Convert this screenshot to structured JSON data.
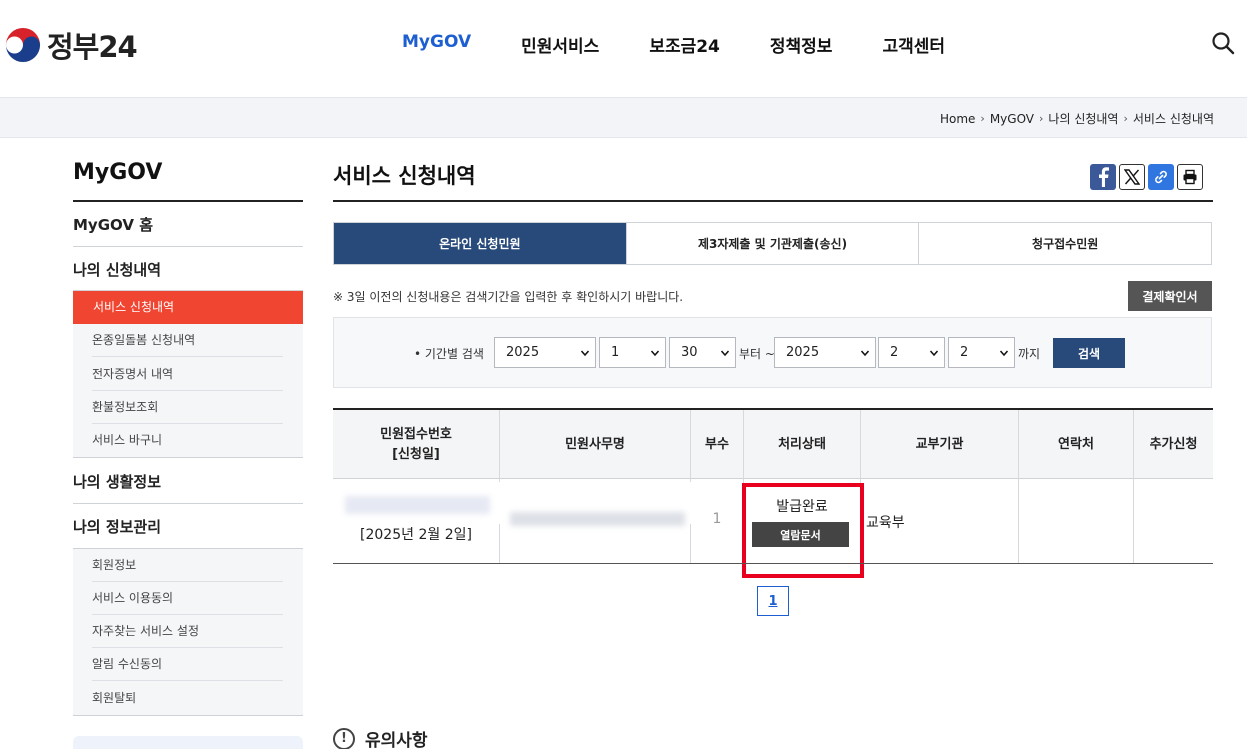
{
  "header": {
    "logo_text": "정부24",
    "nav": [
      "MyGOV",
      "민원서비스",
      "보조금24",
      "정책정보",
      "고객센터"
    ],
    "nav_active": "MyGOV"
  },
  "breadcrumb": [
    "Home",
    "MyGOV",
    "나의 신청내역",
    "서비스 신청내역"
  ],
  "sidebar": {
    "title": "MyGOV",
    "home": "MyGOV 홈",
    "group1": {
      "title": "나의 신청내역",
      "items": [
        "서비스 신청내역",
        "온종일돌봄 신청내역",
        "전자증명서 내역",
        "환불정보조회",
        "서비스 바구니"
      ]
    },
    "group2": {
      "title": "나의 생활정보"
    },
    "group3": {
      "title": "나의 정보관리",
      "items": [
        "회원정보",
        "서비스 이용동의",
        "자주찾는 서비스 설정",
        "알림 수신동의",
        "회원탈퇴"
      ]
    }
  },
  "main": {
    "title": "서비스 신청내역",
    "tabs": [
      "온라인 신청민원",
      "제3자제출 및 기관제출(송신)",
      "청구접수민원"
    ],
    "notice": "※ 3일 이전의 신청내용은 검색기간을 입력한 후 확인하시기 바랍니다.",
    "receipt_button": "결제확인서",
    "search": {
      "label": "• 기간별 검색",
      "from_year": "2025",
      "from_month": "1",
      "from_day": "30",
      "from_suffix": "부터 ~",
      "to_year": "2025",
      "to_month": "2",
      "to_day": "2",
      "to_suffix": "까지",
      "button": "검색"
    },
    "table": {
      "headers": {
        "receipt_no_line1": "민원접수번호",
        "receipt_no_line2": "[신청일]",
        "name": "민원사무명",
        "copies": "부수",
        "status": "처리상태",
        "agency": "교부기관",
        "contact": "연락처",
        "extra": "추가신청"
      },
      "row": {
        "date": "[2025년 2월 2일]",
        "copies": "1",
        "status": "발급완료",
        "doc_button": "열람문서",
        "agency": "교육부"
      }
    },
    "page": "1",
    "caution_title": "유의사항",
    "caution_icon": "!"
  },
  "colors": {
    "accent_blue": "#274a7a",
    "nav_active": "#1d5fd1",
    "sidebar_active": "#f04531",
    "highlight_red": "#e8001e"
  }
}
